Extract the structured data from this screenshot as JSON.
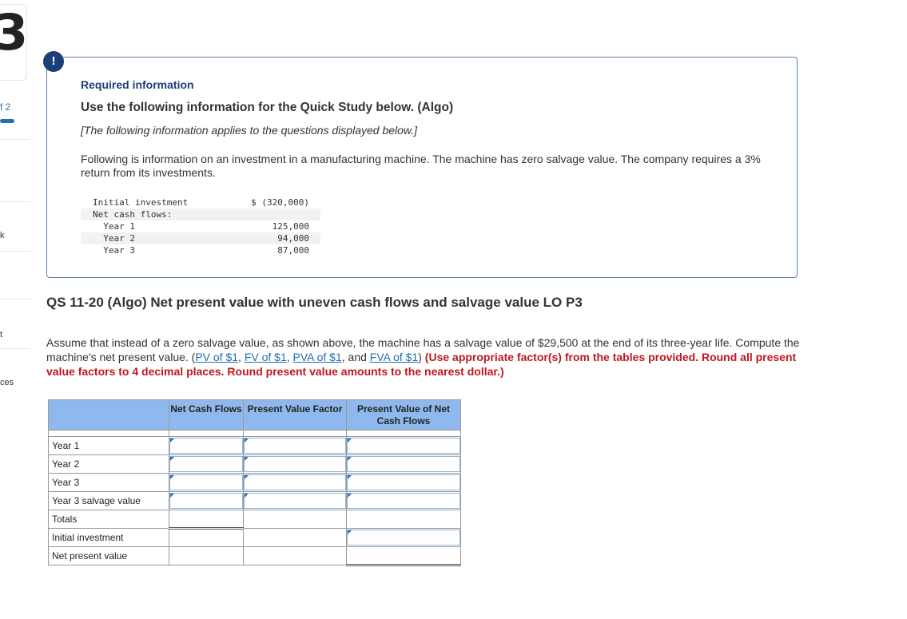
{
  "sidebar": {
    "number": "3",
    "of_text": "f 2",
    "item_k": "k",
    "item_t": "t",
    "item_ces": "ces"
  },
  "info": {
    "alert_glyph": "!",
    "required_title": "Required information",
    "use_line": "Use the following information for the Quick Study below. (Algo)",
    "applies_line": "[The following information applies to the questions displayed below.]",
    "following_text": "Following is information on an investment in a manufacturing machine. The machine has zero salvage value. The company requires a 3% return from its investments.",
    "table": [
      {
        "label": "Initial investment",
        "value": "$ (320,000)"
      },
      {
        "label": "Net cash flows:",
        "value": ""
      },
      {
        "label": "  Year 1",
        "value": "125,000"
      },
      {
        "label": "  Year 2",
        "value": "94,000"
      },
      {
        "label": "  Year 3",
        "value": "87,000"
      }
    ]
  },
  "question": {
    "title": "QS 11-20 (Algo) Net present value with uneven cash flows and salvage value LO P3",
    "text_before_links": "Assume that instead of a zero salvage value, as shown above, the machine has a salvage value of $29,500 at the end of its three-year life. Compute the machine's net present value. (",
    "links": [
      "PV of $1",
      "FV of $1",
      "PVA of $1",
      "FVA of $1"
    ],
    "sep1": ", ",
    "sep2": ", ",
    "sep3": ", and ",
    "after_links": ") ",
    "instruction": "(Use appropriate factor(s) from the tables provided. Round all present value factors to 4 decimal places. Round present value amounts to the nearest dollar.)"
  },
  "answer_table": {
    "headers": [
      "",
      "Net Cash Flows",
      "Present Value Factor",
      "Present Value of Net Cash Flows"
    ],
    "rows": [
      "Year 1",
      "Year 2",
      "Year 3",
      "Year 3 salvage value",
      "Totals",
      "Initial investment",
      "Net present value"
    ]
  }
}
